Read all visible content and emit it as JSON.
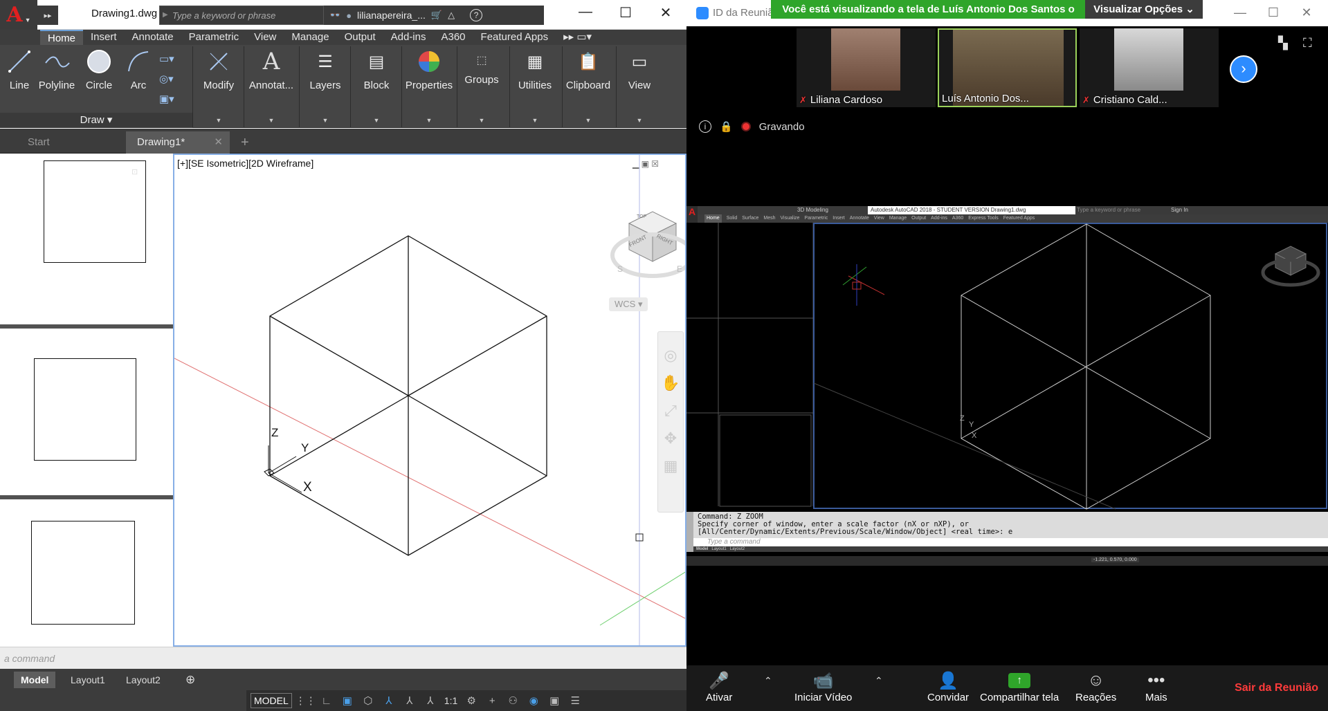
{
  "acad": {
    "doc_name": "Drawing1.dwg",
    "search_placeholder": "Type a keyword or phrase",
    "user": "lilianapereira_...",
    "ribbon_tabs": [
      "Home",
      "Insert",
      "Annotate",
      "Parametric",
      "View",
      "Manage",
      "Output",
      "Add-ins",
      "A360",
      "Featured Apps"
    ],
    "draw_tools": [
      "Line",
      "Polyline",
      "Circle",
      "Arc"
    ],
    "draw_panel": "Draw",
    "panels": [
      "Modify",
      "Annotat...",
      "Layers",
      "Block",
      "Properties",
      "Groups",
      "Utilities",
      "Clipboard",
      "View"
    ],
    "doc_tabs": [
      "Start",
      "Drawing1*"
    ],
    "viewport_label": "[+][SE Isometric][2D Wireframe]",
    "wcs_label": "WCS",
    "viewcube": {
      "top": "TOP",
      "front": "FRONT",
      "right": "RIGHT",
      "s": "S",
      "e": "E"
    },
    "axis_labels": {
      "z": "Z",
      "y": "Y",
      "x": "X"
    },
    "command_placeholder": "a command",
    "layout_tabs": [
      "Model",
      "Layout1",
      "Layout2"
    ],
    "status_model": "MODEL",
    "scale": "1:1"
  },
  "zoom": {
    "window_title": "ID da Reunião",
    "banner": "Você está visualizando a tela de Luís Antonio Dos Santos o",
    "view_options": "Visualizar Opções",
    "participants": [
      {
        "name": "Liliana Cardoso",
        "muted": true
      },
      {
        "name": "Luís Antonio Dos...",
        "muted": false
      },
      {
        "name": "Cristiano Cald...",
        "muted": true
      }
    ],
    "recording": "Gravando",
    "toolbar": {
      "mute": "Ativar",
      "video": "Iniciar Vídeo",
      "invite": "Convidar",
      "share": "Compartilhar tela",
      "reactions": "Reações",
      "more": "Mais",
      "leave": "Sair da Reunião"
    },
    "shared": {
      "title": "Autodesk AutoCAD 2018 - STUDENT VERSION    Drawing1.dwg",
      "workspace": "3D Modeling",
      "tabs": [
        "Home",
        "Solid",
        "Surface",
        "Mesh",
        "Visualize",
        "Parametric",
        "Insert",
        "Annotate",
        "View",
        "Manage",
        "Output",
        "Add-ins",
        "A360",
        "Express Tools",
        "Featured Apps"
      ],
      "search": "Type a keyword or phrase",
      "sign_in": "Sign In",
      "cmd_lines": [
        "Command: Z ZOOM",
        "Specify corner of window, enter a scale factor (nX or nXP), or",
        "[All/Center/Dynamic/Extents/Previous/Scale/Window/Object] <real time>: e"
      ],
      "cmd_placeholder": "Type a command",
      "layout_tabs": [
        "Model",
        "Layout1",
        "Layout2"
      ],
      "coords": "-1.221, 0.570, 0.000"
    },
    "colors": {
      "banner": "#2fa52a",
      "accent": "#2d8cff",
      "leave": "#ff3b3b"
    }
  }
}
